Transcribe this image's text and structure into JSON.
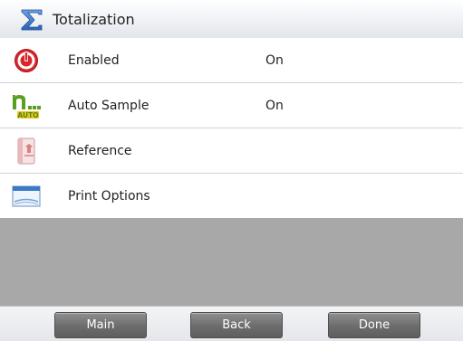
{
  "header": {
    "title": "Totalization",
    "icon": "sigma-icon"
  },
  "rows": [
    {
      "label": "Enabled",
      "value": "On",
      "icon": "power-icon"
    },
    {
      "label": "Auto Sample",
      "value": "On",
      "icon": "auto-sample-icon",
      "icon_text": "AUTO"
    },
    {
      "label": "Reference",
      "value": "",
      "icon": "reference-book-icon"
    },
    {
      "label": "Print Options",
      "value": "",
      "icon": "print-window-icon"
    }
  ],
  "footer": {
    "main_label": "Main",
    "back_label": "Back",
    "done_label": "Done"
  },
  "colors": {
    "accent_blue": "#3b78c8",
    "power_red": "#d9262b",
    "auto_green": "#5aa020",
    "auto_yellow": "#f1c21b",
    "empty_gray": "#a8a8a8",
    "button_gray": "#6c6c6c"
  }
}
